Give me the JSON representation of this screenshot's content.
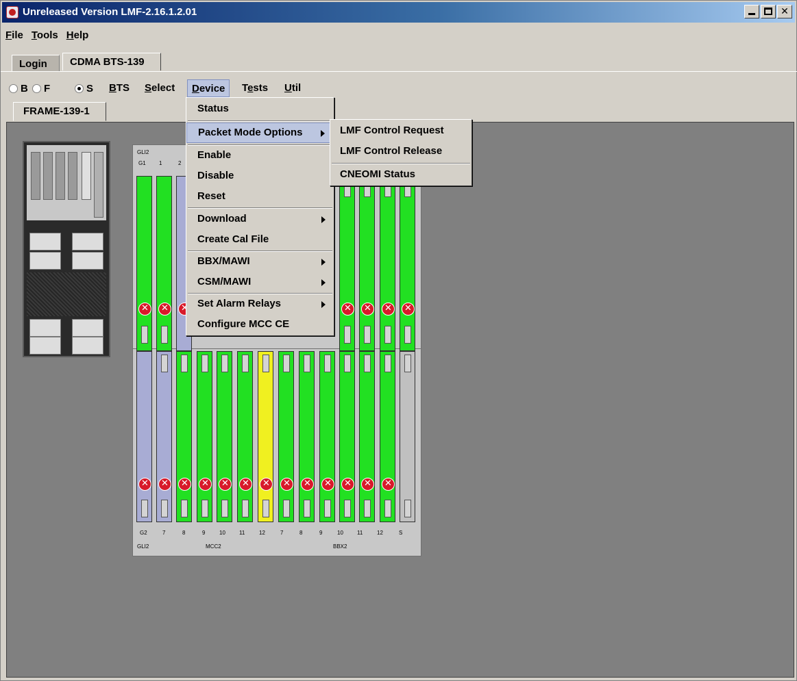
{
  "window": {
    "title": "Unreleased Version LMF-2.16.1.2.01"
  },
  "menubar": [
    {
      "label": "File",
      "mn": "F",
      "rest": "ile"
    },
    {
      "label": "Tools",
      "mn": "T",
      "rest": "ools"
    },
    {
      "label": "Help",
      "mn": "H",
      "rest": "elp"
    }
  ],
  "tabs": {
    "login": "Login",
    "bts": "CDMA BTS-139"
  },
  "toolbar": {
    "radio_b": "B",
    "radio_f": "F",
    "radio_s": "S",
    "selected_radio": "S",
    "bts": "BTS",
    "select": "Select",
    "device": "Device",
    "tests": "Tests",
    "util": "Util"
  },
  "frame_tab": "FRAME-139-1",
  "device_menu": {
    "status": "Status",
    "packet_mode": "Packet Mode Options",
    "enable": "Enable",
    "disable": "Disable",
    "reset": "Reset",
    "download": "Download",
    "create_cal": "Create Cal File",
    "bbx": "BBX/MAWI",
    "csm": "CSM/MAWI",
    "alarm": "Set Alarm Relays",
    "configure": "Configure MCC CE"
  },
  "packet_submenu": {
    "control_request": "LMF Control Request",
    "control_release": "LMF Control Release",
    "cneomi": "CNEOMI Status"
  },
  "shelf_top": {
    "group": "GLI2",
    "slots": [
      "G1",
      "1",
      "2"
    ]
  },
  "shelf_bottom": {
    "slots": [
      "G2",
      "7",
      "8",
      "9",
      "10",
      "11",
      "12",
      "7",
      "8",
      "9",
      "10",
      "11",
      "12",
      "S"
    ],
    "groups": [
      "GLI2",
      "MCC2",
      "BBX2"
    ]
  },
  "colors": {
    "card_green": "#22e022",
    "card_lavender": "#a8acd4",
    "card_yellow": "#f0f020",
    "card_gray": "#c0c0c0",
    "alarm_red": "#d81a2a"
  }
}
